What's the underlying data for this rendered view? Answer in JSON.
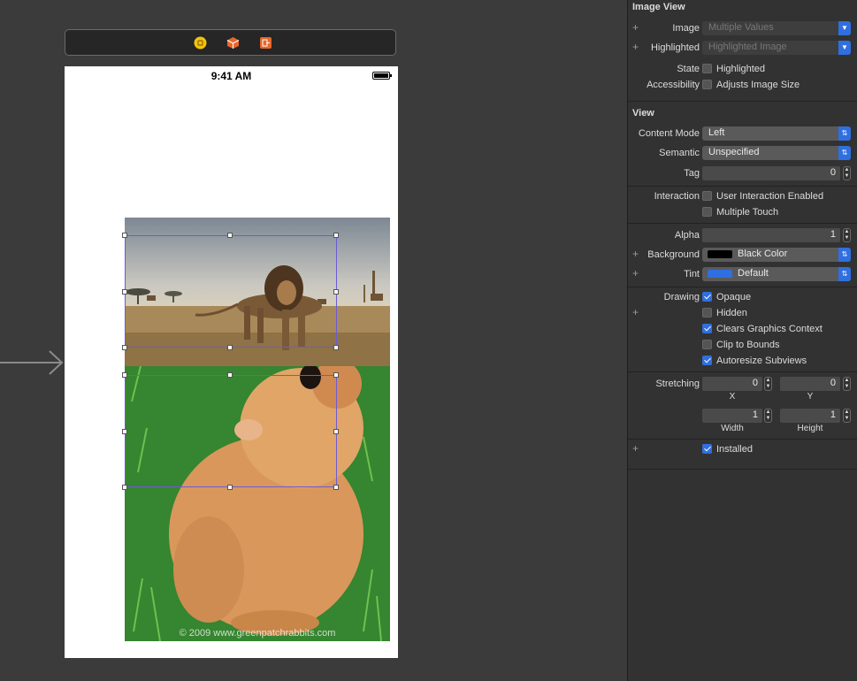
{
  "canvas": {
    "status_time": "9:41 AM",
    "watermark": "© 2009 www.greenpatchrabbits.com"
  },
  "scene_bar": {
    "icons": [
      "view-controller-icon",
      "first-responder-icon",
      "exit-icon"
    ]
  },
  "inspector": {
    "image_view": {
      "title": "Image View",
      "image_label": "Image",
      "image_value": "Multiple Values",
      "highlighted_label": "Highlighted",
      "highlighted_value": "Highlighted Image",
      "state_label": "State",
      "state_checkbox_label": "Highlighted",
      "accessibility_label": "Accessibility",
      "accessibility_checkbox_label": "Adjusts Image Size"
    },
    "view": {
      "title": "View",
      "content_mode_label": "Content Mode",
      "content_mode_value": "Left",
      "semantic_label": "Semantic",
      "semantic_value": "Unspecified",
      "tag_label": "Tag",
      "tag_value": "0",
      "interaction_label": "Interaction",
      "user_interaction_label": "User Interaction Enabled",
      "multiple_touch_label": "Multiple Touch",
      "alpha_label": "Alpha",
      "alpha_value": "1",
      "background_label": "Background",
      "background_value": "Black Color",
      "background_color": "#000000",
      "tint_label": "Tint",
      "tint_value": "Default",
      "tint_color": "#2f6fe0",
      "drawing_label": "Drawing",
      "opaque_label": "Opaque",
      "hidden_label": "Hidden",
      "clears_graphics_label": "Clears Graphics Context",
      "clip_bounds_label": "Clip to Bounds",
      "autoresize_label": "Autoresize Subviews",
      "stretching_label": "Stretching",
      "stretch_x": "0",
      "stretch_x_label": "X",
      "stretch_y": "0",
      "stretch_y_label": "Y",
      "stretch_width": "1",
      "stretch_width_label": "Width",
      "stretch_height": "1",
      "stretch_height_label": "Height",
      "installed_label": "Installed"
    },
    "checkboxes": {
      "highlighted": false,
      "adjusts_image_size": false,
      "user_interaction": false,
      "multiple_touch": false,
      "opaque": true,
      "hidden": false,
      "clears_graphics": true,
      "clip_bounds": false,
      "autoresize": true,
      "installed": true
    }
  }
}
